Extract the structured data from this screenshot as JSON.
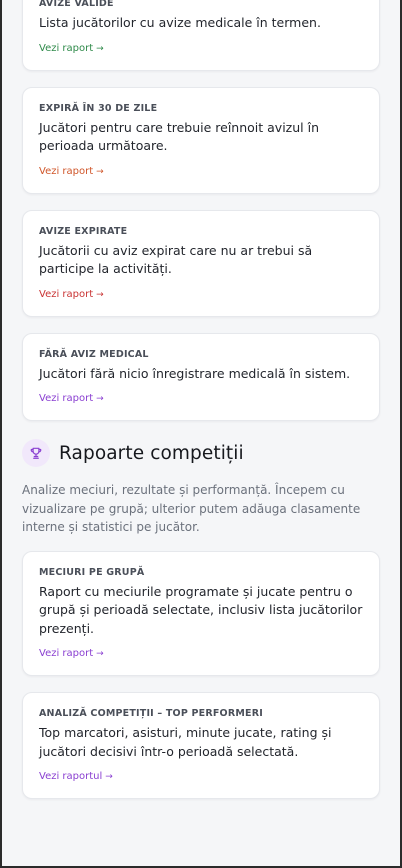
{
  "cards_medical": [
    {
      "title": "AVIZE VALIDE",
      "description": "Lista jucătorilor cu avize medicale în termen.",
      "link_label": "Vezi raport",
      "link_arrow": "→",
      "link_color": "#2f8a4a"
    },
    {
      "title": "EXPIRĂ ÎN 30 DE ZILE",
      "description": "Jucători pentru care trebuie reînnoit avizul în perioada următoare.",
      "link_label": "Vezi raport",
      "link_arrow": "→",
      "link_color": "#d0562a"
    },
    {
      "title": "AVIZE EXPIRATE",
      "description": "Jucătorii cu aviz expirat care nu ar trebui să participe la activități.",
      "link_label": "Vezi raport",
      "link_arrow": "→",
      "link_color": "#c93434"
    },
    {
      "title": "FĂRĂ AVIZ MEDICAL",
      "description": "Jucători fără nicio înregistrare medicală în sistem.",
      "link_label": "Vezi raport",
      "link_arrow": "→",
      "link_color": "#8a3fd1"
    }
  ],
  "competitions_section": {
    "icon": "trophy-icon",
    "icon_bg": "#f1e8fb",
    "icon_color": "#8a3fd1",
    "title": "Rapoarte competiții",
    "description": "Analize meciuri, rezultate și performanță. Începem cu vizualizare pe grupă; ulterior putem adăuga clasamente interne și statistici pe jucător."
  },
  "cards_competitions": [
    {
      "title": "MECIURI PE GRUPĂ",
      "description": "Raport cu meciurile programate și jucate pentru o grupă și perioadă selectate, inclusiv lista jucătorilor prezenți.",
      "link_label": "Vezi raport",
      "link_arrow": "→",
      "link_color": "#8a3fd1"
    },
    {
      "title": "ANALIZĂ COMPETIȚII – TOP PERFORMERI",
      "description": "Top marcatori, asisturi, minute jucate, rating și jucători decisivi într-o perioadă selectată.",
      "link_label": "Vezi raportul",
      "link_arrow": "→",
      "link_color": "#8a3fd1"
    }
  ]
}
